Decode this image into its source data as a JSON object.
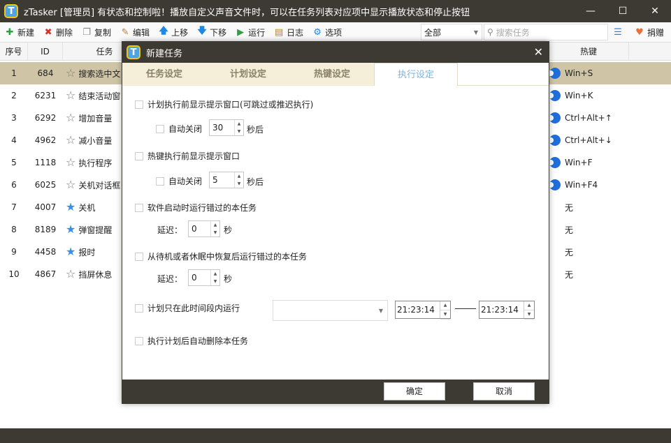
{
  "app": {
    "logo_letter": "T",
    "title": "zTasker [管理员]   有状态和控制啦！播放自定义声音文件时，可以在任务列表对应项中显示播放状态和停止按钮",
    "win_min": "—",
    "win_max": "☐",
    "win_close": "✕"
  },
  "toolbar": {
    "new": "新建",
    "delete": "删除",
    "copy": "复制",
    "edit": "编辑",
    "up": "上移",
    "down": "下移",
    "run": "运行",
    "log": "日志",
    "options": "选项",
    "filter_value": "全部",
    "search_placeholder": "搜索任务",
    "donate": "捐赠",
    "colors": {
      "new": "#2ea043",
      "delete": "#d93025",
      "up": "#1e88e5",
      "down": "#1e88e5",
      "run": "#2ea043",
      "options": "#1e88e5"
    }
  },
  "table": {
    "headers": {
      "no": "序号",
      "id": "ID",
      "task": "任务",
      "hotkey": "热键"
    },
    "rows": [
      {
        "no": "1",
        "id": "684",
        "task": "搜索选中文",
        "star": "☆",
        "hotkey": "Win+S",
        "toggle": true
      },
      {
        "no": "2",
        "id": "6231",
        "task": "结束活动窗",
        "star": "☆",
        "hotkey": "Win+K",
        "toggle": true
      },
      {
        "no": "3",
        "id": "6292",
        "task": "增加音量",
        "star": "☆",
        "hotkey": "Ctrl+Alt+↑",
        "toggle": true
      },
      {
        "no": "4",
        "id": "4962",
        "task": "减小音量",
        "star": "☆",
        "hotkey": "Ctrl+Alt+↓",
        "toggle": true
      },
      {
        "no": "5",
        "id": "1118",
        "task": "执行程序",
        "star": "☆",
        "hotkey": "Win+F",
        "toggle": true
      },
      {
        "no": "6",
        "id": "6025",
        "task": "关机对话框",
        "star": "☆",
        "hotkey": "Win+F4",
        "toggle": true
      },
      {
        "no": "7",
        "id": "4007",
        "task": "关机",
        "star": "★",
        "hotkey": "无",
        "toggle": false
      },
      {
        "no": "8",
        "id": "8189",
        "task": "弹窗提醒",
        "star": "★",
        "hotkey": "无",
        "toggle": false
      },
      {
        "no": "9",
        "id": "4458",
        "task": "报时",
        "star": "★",
        "hotkey": "无",
        "toggle": false
      },
      {
        "no": "10",
        "id": "4867",
        "task": "挡屏休息",
        "star": "☆",
        "hotkey": "无",
        "toggle": false
      }
    ]
  },
  "dialog": {
    "title": "新建任务",
    "close": "✕",
    "tabs": [
      "任务设定",
      "计划设定",
      "热键设定",
      "执行设定"
    ],
    "prompt_before_plan": "计划执行前显示提示窗口(可跳过或推迟执行)",
    "auto_close": "自动关闭",
    "plan_seconds": "30",
    "seconds_after": "秒后",
    "prompt_before_hotkey": "热键执行前显示提示窗口",
    "hotkey_seconds": "5",
    "run_missed_startup": "软件启动时运行错过的本任务",
    "delay_label": "延迟：",
    "delay_startup": "0",
    "seconds": "秒",
    "run_missed_resume": "从待机或者休眠中恢复后运行错过的本任务",
    "delay_resume": "0",
    "run_in_period": "计划只在此时间段内运行",
    "time_start": "21:23:14",
    "time_end": "21:23:14",
    "delete_after": "执行计划后自动删除本任务",
    "ok": "确定",
    "cancel": "取消"
  }
}
